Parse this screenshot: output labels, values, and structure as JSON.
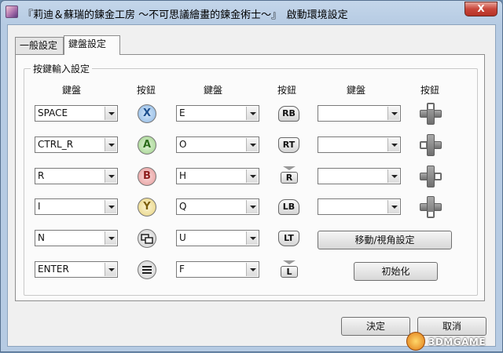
{
  "window": {
    "title": "『莉迪＆蘇瑞的鍊金工房 ～不可思議繪畫的鍊金術士～』　啟動環境設定",
    "close_label": "X"
  },
  "tabs": [
    {
      "label": "一般設定"
    },
    {
      "label": "鍵盤設定"
    }
  ],
  "group": {
    "title": "按鍵輸入設定",
    "headers": [
      "鍵盤",
      "按鈕",
      "鍵盤",
      "按鈕",
      "鍵盤",
      "按鈕"
    ]
  },
  "col1_keys": [
    "SPACE",
    "CTRL_R",
    "R",
    "I",
    "N",
    "ENTER"
  ],
  "col1_buttons": [
    "X",
    "A",
    "B",
    "Y",
    "view-button",
    "menu-button"
  ],
  "col2_keys": [
    "E",
    "O",
    "H",
    "Q",
    "U",
    "F"
  ],
  "col2_buttons": [
    "RB",
    "RT",
    "R",
    "LB",
    "LT",
    "L"
  ],
  "col3_keys": [
    "",
    "",
    "",
    ""
  ],
  "col3_buttons": [
    "dpad-up",
    "dpad-left",
    "dpad-right",
    "dpad-down"
  ],
  "buttons": {
    "move_view": "移動/視角設定",
    "reset": "初始化",
    "ok": "決定",
    "cancel": "取消"
  },
  "watermark": {
    "text": "3DMGAME"
  },
  "colors": {
    "face_x": "#8db7e3",
    "face_a": "#9fd18a",
    "face_b": "#e59a9a",
    "face_y": "#e7d27e"
  }
}
